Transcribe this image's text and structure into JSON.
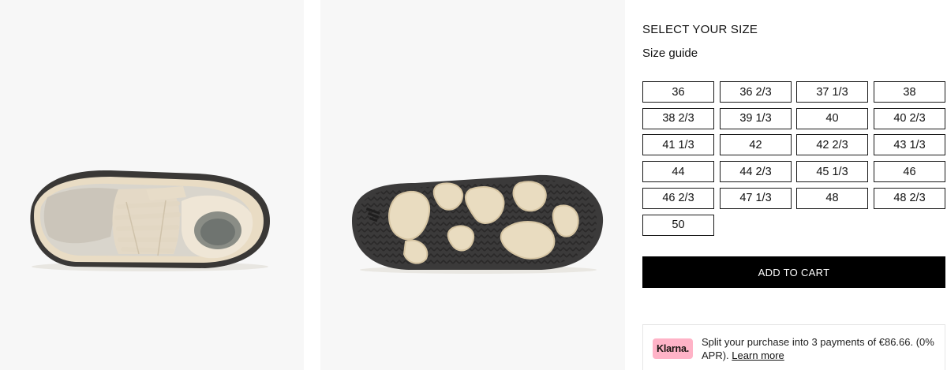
{
  "gallery": {
    "images": [
      {
        "view": "top",
        "icon": "sneaker-top-view-image"
      },
      {
        "view": "sole",
        "icon": "sneaker-sole-image"
      }
    ]
  },
  "size_selector": {
    "heading": "SELECT YOUR SIZE",
    "guide_label": "Size guide",
    "sizes": [
      "36",
      "36 2/3",
      "37 1/3",
      "38",
      "38 2/3",
      "39 1/3",
      "40",
      "40 2/3",
      "41 1/3",
      "42",
      "42 2/3",
      "43 1/3",
      "44",
      "44 2/3",
      "45 1/3",
      "46",
      "46 2/3",
      "47 1/3",
      "48",
      "48 2/3",
      "50"
    ]
  },
  "cart": {
    "add_label": "ADD TO CART"
  },
  "klarna": {
    "logo_text": "Klarna.",
    "message": "Split your purchase into 3 payments of €86.66. (0% APR).",
    "link_label": "Learn more",
    "brand_color": "#ffb3c7"
  }
}
